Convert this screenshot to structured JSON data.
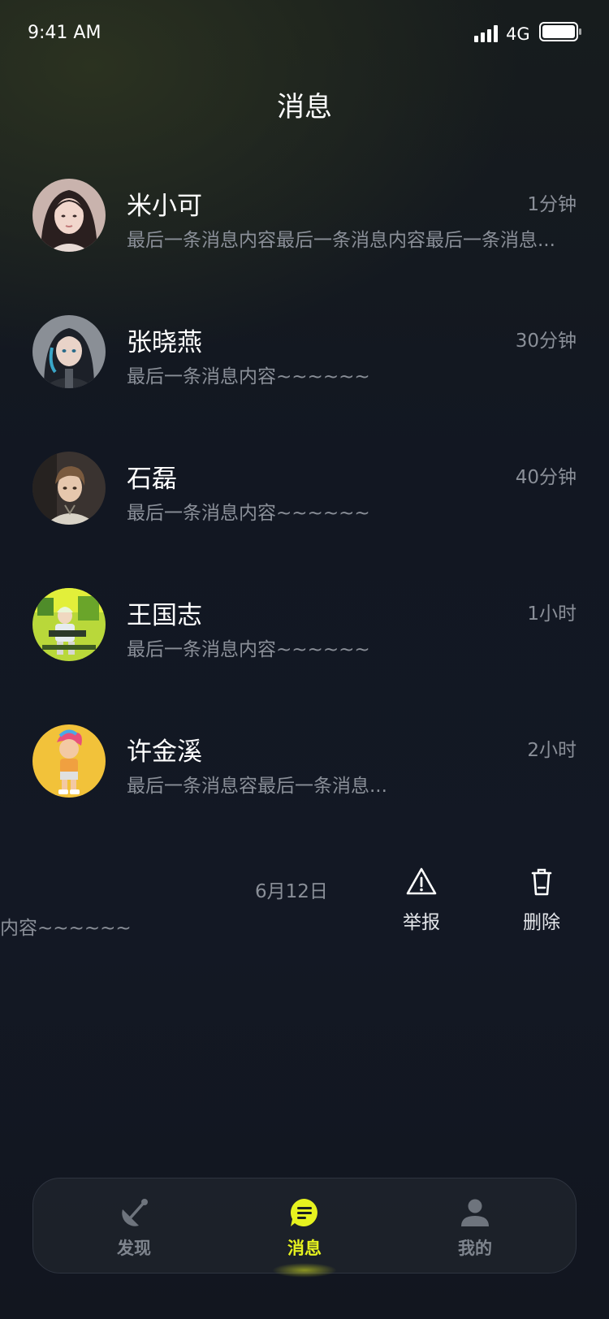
{
  "status_bar": {
    "time": "9:41 AM",
    "network": "4G"
  },
  "header": {
    "title": "消息"
  },
  "chats": [
    {
      "name": "米小可",
      "preview": "最后一条消息内容最后一条消息内容最后一条消息...",
      "time": "1分钟",
      "avatar_icon": "avatar-girl-photo"
    },
    {
      "name": "张晓燕",
      "preview": "最后一条消息内容~~~~~~",
      "time": "30分钟",
      "avatar_icon": "avatar-anime-girl"
    },
    {
      "name": "石磊",
      "preview": "最后一条消息内容~~~~~~",
      "time": "40分钟",
      "avatar_icon": "avatar-anime-boy"
    },
    {
      "name": "王国志",
      "preview": "最后一条消息内容~~~~~~",
      "time": "1小时",
      "avatar_icon": "avatar-gamer-green"
    },
    {
      "name": "许金溪",
      "preview": "最后一条消息容最后一条消息...",
      "time": "2小时",
      "avatar_icon": "avatar-cartoon-kid"
    }
  ],
  "swiped_item": {
    "preview_fragment": "内容~~~~~~",
    "time": "6月12日",
    "actions": {
      "report": "举报",
      "delete": "删除"
    }
  },
  "tabbar": {
    "tabs": [
      {
        "label": "发现",
        "icon": "satellite-dish-icon",
        "active": false
      },
      {
        "label": "消息",
        "icon": "message-icon",
        "active": true
      },
      {
        "label": "我的",
        "icon": "person-icon",
        "active": false
      }
    ]
  },
  "colors": {
    "accent": "#e6f21f",
    "muted_text": "#8a8f98",
    "background": "#131824"
  }
}
